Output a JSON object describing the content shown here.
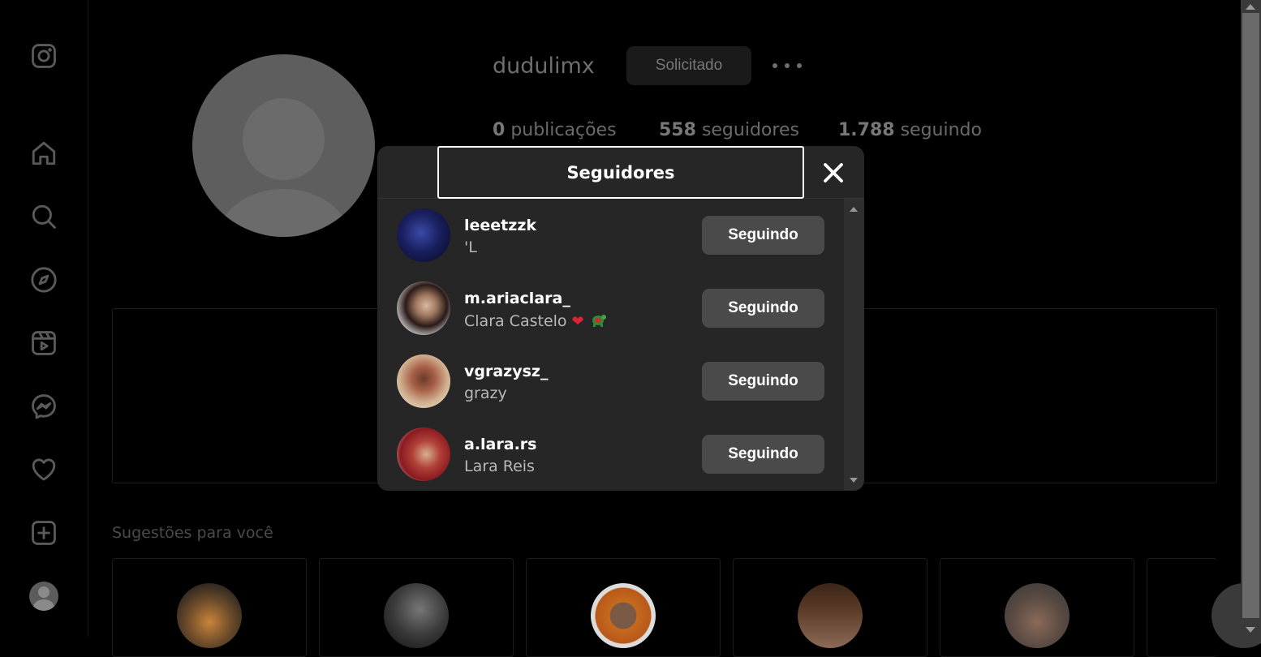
{
  "profile": {
    "username": "dudulimx",
    "request_button": "Solicitado",
    "stats": [
      {
        "count": "0",
        "label": "publicações"
      },
      {
        "count": "558",
        "label": "seguidores"
      },
      {
        "count": "1.788",
        "label": "seguindo"
      }
    ]
  },
  "suggestions": {
    "title": "Sugestões para você"
  },
  "modal": {
    "title": "Seguidores",
    "followers": [
      {
        "username": "leeetzzk",
        "name": "'L",
        "button": "Seguindo"
      },
      {
        "username": "m.ariaclara_",
        "name": "Clara Castelo",
        "button": "Seguindo"
      },
      {
        "username": "vgrazysz_",
        "name": "grazy",
        "button": "Seguindo"
      },
      {
        "username": "a.lara.rs",
        "name": "Lara Reis",
        "button": "Seguindo"
      }
    ]
  },
  "icons": {
    "sidebar": [
      "instagram-icon",
      "home-icon",
      "search-icon",
      "explore-icon",
      "reels-icon",
      "messenger-icon",
      "heart-icon",
      "create-icon"
    ],
    "emoji": [
      "red-heart-icon",
      "turtle-icon"
    ]
  }
}
